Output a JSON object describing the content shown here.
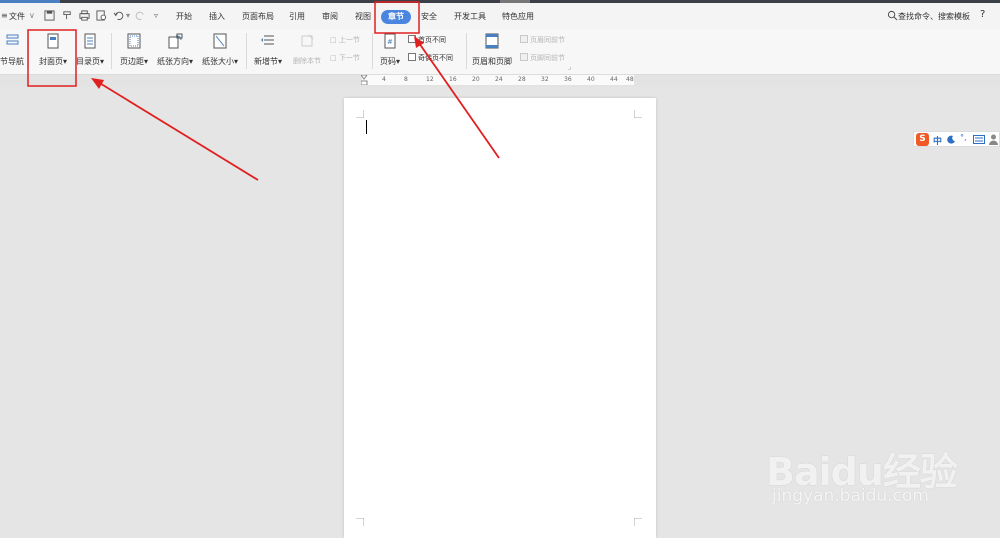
{
  "menubar": {
    "file": "文件",
    "tabs": [
      "开始",
      "插入",
      "页面布局",
      "引用",
      "审阅",
      "视图",
      "章节",
      "安全",
      "开发工具",
      "特色应用"
    ],
    "active_tab": "章节",
    "search": "查找命令、搜索模板",
    "help": "?"
  },
  "ribbon": {
    "section_nav": "节导航",
    "cover_page": "封面页",
    "toc_page": "目录页",
    "margins": "页边距",
    "orientation": "纸张方向",
    "paper_size": "纸张大小",
    "new_section": "新增节",
    "delete_section": "删除本节",
    "prev_section": "上一节",
    "next_section": "下一节",
    "page_number": "页码",
    "first_page_different": "首页不同",
    "odd_even_different": "奇偶页不同",
    "header_footer": "页眉和页脚",
    "header_same_as_prev": "页眉同前节",
    "footer_same_as_prev": "页脚同前节"
  },
  "ruler": {
    "ticks": [
      "4",
      "8",
      "12",
      "16",
      "20",
      "24",
      "28",
      "32",
      "36",
      "40",
      "44",
      "48"
    ]
  },
  "ime": {
    "label": "中"
  },
  "watermark": {
    "brand": "Baidu经验",
    "url": "jingyan.baidu.com"
  },
  "colors": {
    "accent": "#4a86e0",
    "annotation": "#e02020",
    "ime": "#f05a24"
  }
}
